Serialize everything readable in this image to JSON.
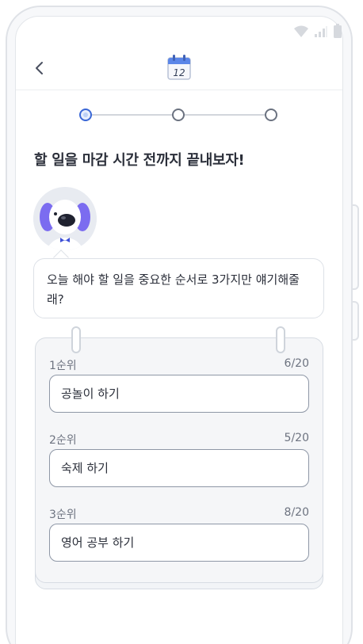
{
  "header": {
    "calendar_day": "12"
  },
  "stepper": {
    "current": 1,
    "total": 3
  },
  "title": "할 일을 마감 시간 전까지 끝내보자!",
  "bubble": {
    "line1": "오늘 해야 할 일을 중요한 순서로 3가지만 얘기해줄",
    "line2": "래?"
  },
  "tasks": [
    {
      "rank": "1순위",
      "count": "6/20",
      "value": "공놀이 하기"
    },
    {
      "rank": "2순위",
      "count": "5/20",
      "value": "숙제 하기"
    },
    {
      "rank": "3순위",
      "count": "8/20",
      "value": "영어 공부 하기"
    }
  ],
  "colors": {
    "accent": "#3a67d6",
    "border": "#8e97a6",
    "text": "#2b2f3a"
  },
  "icons": {
    "back": "chevron-left-icon",
    "calendar": "calendar-icon",
    "wifi": "wifi-icon",
    "signal": "signal-icon",
    "battery": "battery-icon",
    "avatar": "dog-avatar"
  }
}
